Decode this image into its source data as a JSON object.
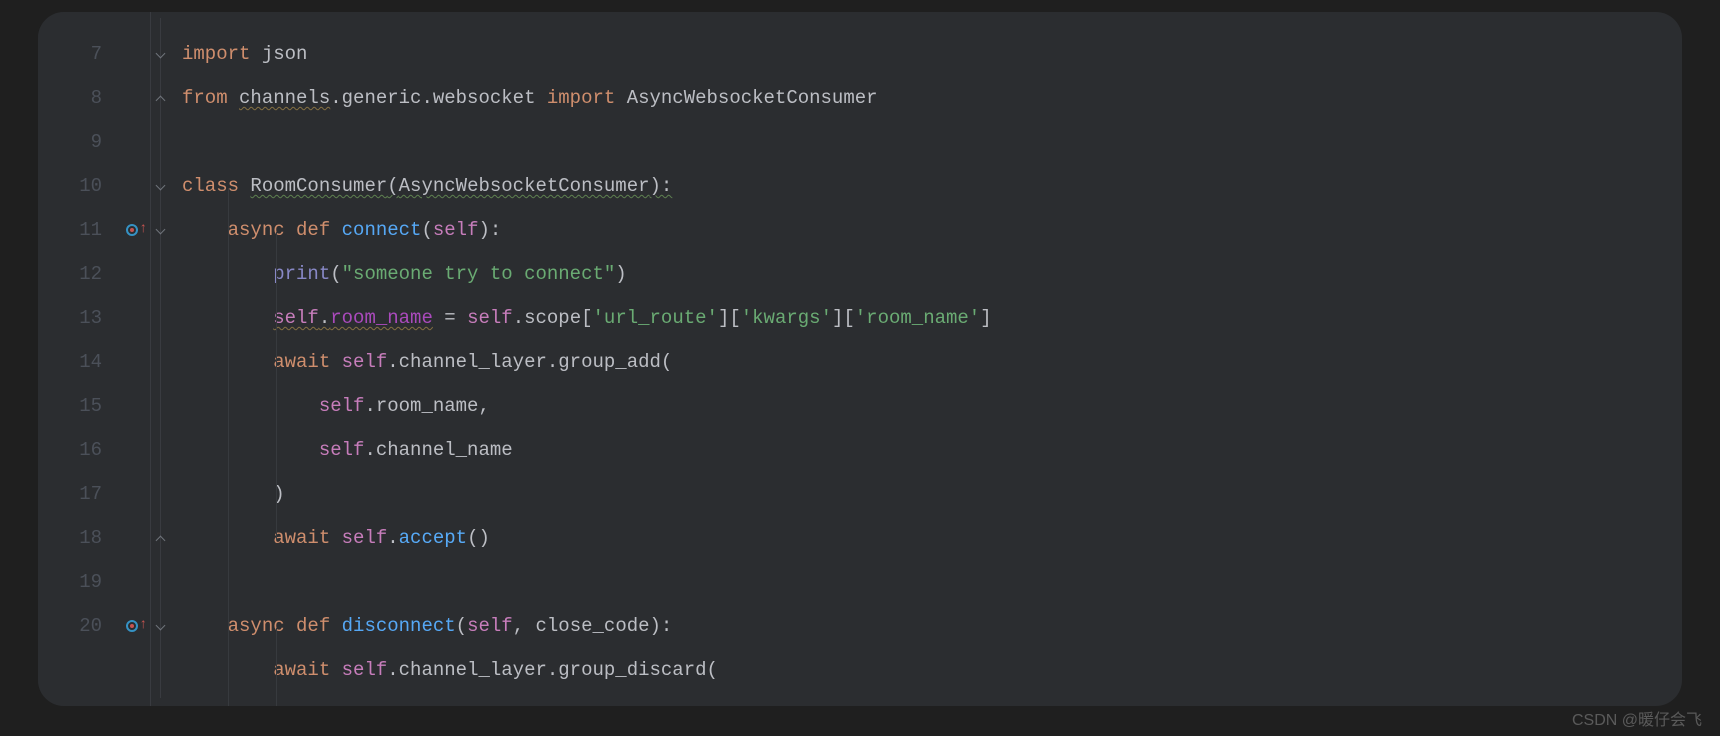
{
  "watermark": "CSDN @暖仔会飞",
  "line_numbers": [
    "7",
    "8",
    "9",
    "10",
    "11",
    "12",
    "13",
    "14",
    "15",
    "16",
    "17",
    "18",
    "19",
    "20",
    ""
  ],
  "code": {
    "l7": {
      "kw_import": "import",
      "mod_json": " json"
    },
    "l8": {
      "kw_from": "from ",
      "mod_channels": "channels",
      "rest": ".generic.websocket ",
      "kw_import": "import",
      "cls": " AsyncWebsocketConsumer"
    },
    "l10": {
      "kw_class": "class ",
      "name": "RoomConsumer",
      "open": "(",
      "base": "AsyncWebsocketConsumer",
      "close": "):"
    },
    "l11": {
      "kw_async": "async ",
      "kw_def": "def ",
      "name": "connect",
      "open": "(",
      "self": "self",
      "close": "):"
    },
    "l12": {
      "fn": "print",
      "open": "(",
      "str": "\"someone try to connect\"",
      "close": ")"
    },
    "l13": {
      "self": "self",
      "dot1": ".",
      "room": "room_name",
      "eq": " = ",
      "self2": "self",
      "dot2": ".scope[",
      "s1": "'url_route'",
      "mid1": "][",
      "s2": "'kwargs'",
      "mid2": "][",
      "s3": "'room_name'",
      "end": "]"
    },
    "l14": {
      "kw_await": "await ",
      "self": "self",
      "rest": ".channel_layer.group_add("
    },
    "l15": {
      "self": "self",
      "rest": ".room_name,"
    },
    "l16": {
      "self": "self",
      "rest": ".channel_name"
    },
    "l17": {
      "paren": ")"
    },
    "l18": {
      "kw_await": "await ",
      "self": "self",
      "dot": ".",
      "fn": "accept",
      "paren": "()"
    },
    "l20": {
      "kw_async": "async ",
      "kw_def": "def ",
      "name": "disconnect",
      "open": "(",
      "self": "self",
      "comma": ", ",
      "param": "close_code",
      "close": "):"
    },
    "l21": {
      "kw_await": "await ",
      "self": "self",
      "rest": ".channel_layer.group_discard("
    }
  }
}
